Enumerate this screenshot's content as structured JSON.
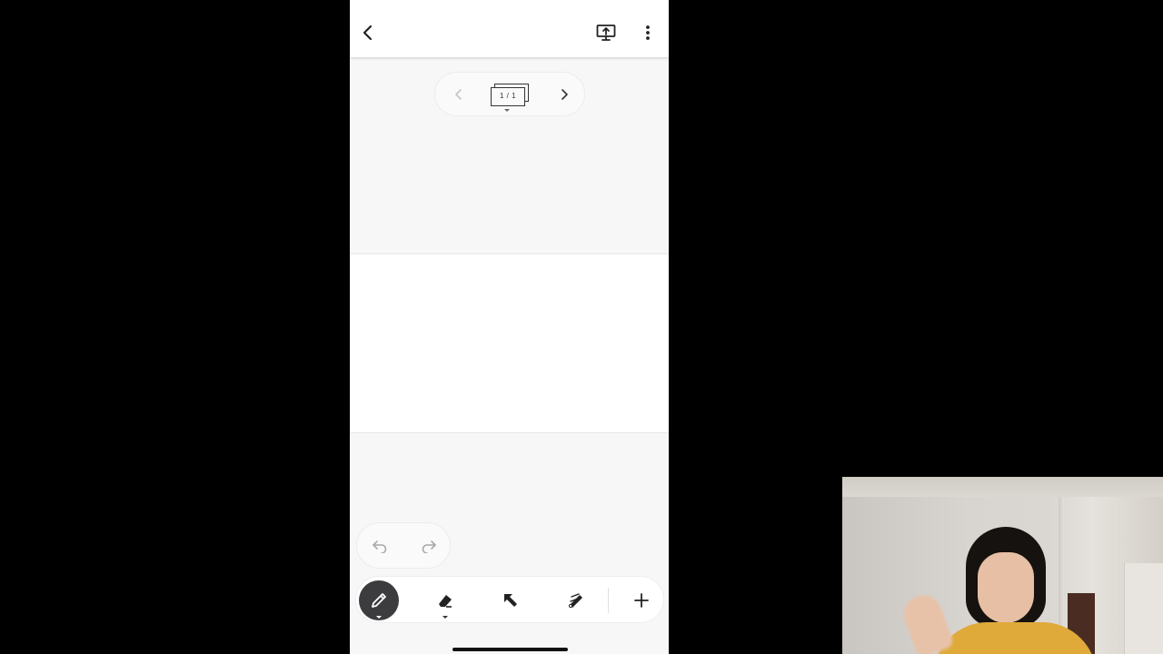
{
  "app": {
    "page_indicator": "1 / 1"
  },
  "icons": {
    "back": "chevron-left-icon",
    "present": "present-screen-icon",
    "more": "more-vertical-icon",
    "prev_page": "chevron-left-icon",
    "next_page": "chevron-right-icon",
    "undo": "undo-icon",
    "redo": "redo-icon",
    "pen": "pen-icon",
    "eraser": "eraser-icon",
    "select": "select-arrow-icon",
    "laser": "laser-pointer-icon",
    "add": "plus-icon"
  },
  "colors": {
    "active_tool_bg": "#3c3c3f",
    "canvas_bg": "#ffffff",
    "app_bg": "#f7f7f8",
    "outer_bg": "#000000"
  },
  "toolbar": {
    "active_tool": "pen"
  }
}
